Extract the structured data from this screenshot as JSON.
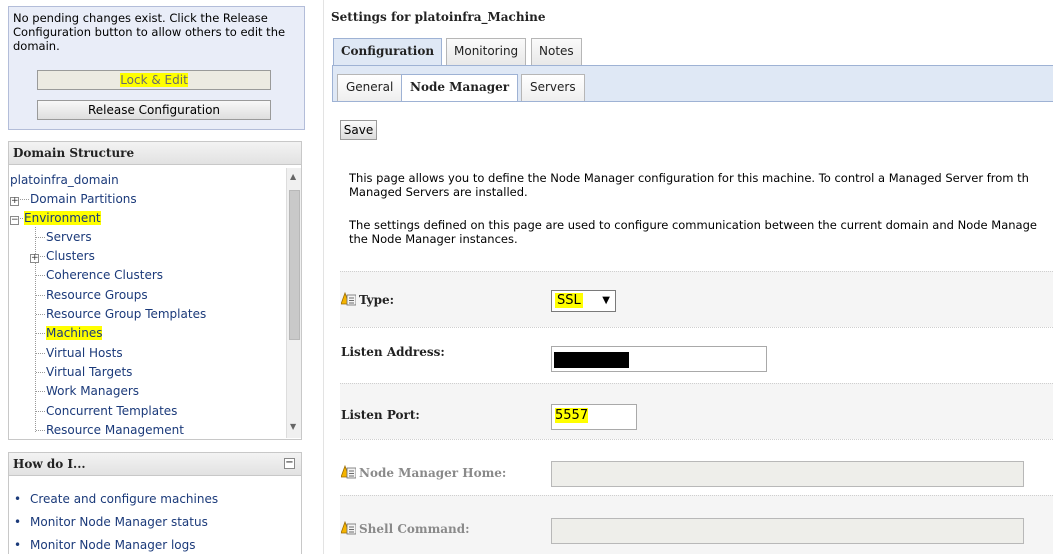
{
  "change_center": {
    "message": "No pending changes exist. Click the Release Configuration button to allow others to edit the domain.",
    "lock_edit_label": "Lock & Edit",
    "release_label": "Release Configuration"
  },
  "domain_structure": {
    "title": "Domain Structure",
    "root": "platoinfra_domain",
    "items": [
      {
        "label": "Domain Partitions"
      },
      {
        "label": "Environment"
      },
      {
        "label": "Servers"
      },
      {
        "label": "Clusters"
      },
      {
        "label": "Coherence Clusters"
      },
      {
        "label": "Resource Groups"
      },
      {
        "label": "Resource Group Templates"
      },
      {
        "label": "Machines"
      },
      {
        "label": "Virtual Hosts"
      },
      {
        "label": "Virtual Targets"
      },
      {
        "label": "Work Managers"
      },
      {
        "label": "Concurrent Templates"
      },
      {
        "label": "Resource Management"
      }
    ]
  },
  "how_do_i": {
    "title": "How do I...",
    "collapse_symbol": "−",
    "items": [
      "Create and configure machines",
      "Monitor Node Manager status",
      "Monitor Node Manager logs"
    ]
  },
  "page": {
    "title": "Settings for platoinfra_Machine",
    "tabs": [
      "Configuration",
      "Monitoring",
      "Notes"
    ],
    "active_tab": "Configuration",
    "subtabs": [
      "General",
      "Node Manager",
      "Servers"
    ],
    "active_subtab": "Node Manager",
    "save_label": "Save",
    "desc1_line1": "This page allows you to define the Node Manager configuration for this machine. To control a Managed Server from th",
    "desc1_line2": "Managed Servers are installed.",
    "desc2_line1": "The settings defined on this page are used to configure communication between the current domain and Node Manage",
    "desc2_line2": "the Node Manager instances."
  },
  "form": {
    "type_label": "Type:",
    "type_value": "SSL",
    "listen_address_label": "Listen Address:",
    "listen_address_value": "",
    "listen_port_label": "Listen Port:",
    "listen_port_value": "5557",
    "nm_home_label": "Node Manager Home:",
    "nm_home_value": "",
    "shell_command_label": "Shell Command:",
    "shell_command_value": ""
  },
  "colors": {
    "highlight": "#ffff00",
    "link": "#1b3a7a",
    "tab_active_bg": "#dfe8f5",
    "change_center_bg": "#e9edf8"
  },
  "icons": {
    "info": "info-warning-icon",
    "expand": "plus-expander-icon",
    "collapse": "minus-expander-icon"
  }
}
